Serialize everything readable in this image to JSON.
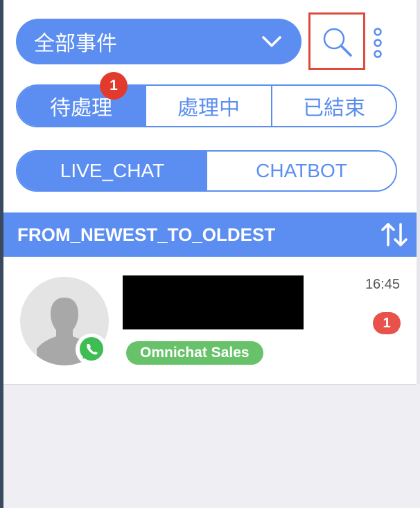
{
  "filter": {
    "label": "全部事件",
    "icon": "chevron-down-icon"
  },
  "toolbar": {
    "search_icon": "search-icon",
    "more_icon": "more-vertical-icon"
  },
  "status_tabs": [
    {
      "label": "待處理",
      "badge": "1",
      "active": true
    },
    {
      "label": "處理中",
      "active": false
    },
    {
      "label": "已結束",
      "active": false
    }
  ],
  "channel_tabs": [
    {
      "label": "LIVE_CHAT",
      "active": true
    },
    {
      "label": "CHATBOT",
      "active": false
    }
  ],
  "sort": {
    "label": "FROM_NEWEST_TO_OLDEST",
    "icon": "sort-icon"
  },
  "conversation": {
    "time": "16:45",
    "unread": "1",
    "tag": "Omnichat Sales",
    "channel_icon": "whatsapp-icon"
  },
  "colors": {
    "accent": "#5b8ef0",
    "highlight": "#de4b3c",
    "badge": "#e23b2e",
    "tag": "#68c26a"
  }
}
